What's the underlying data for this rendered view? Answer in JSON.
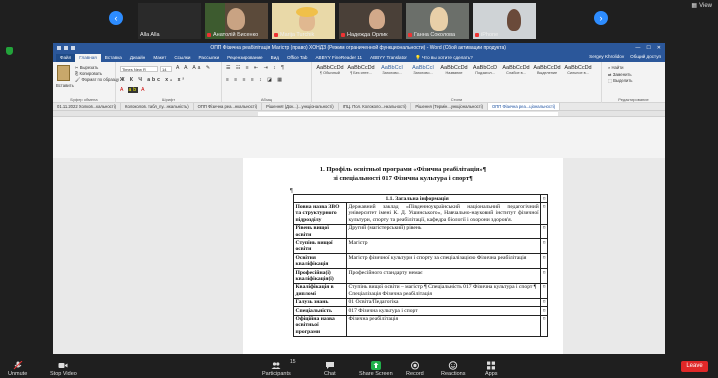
{
  "zoom": {
    "view_label": "View",
    "participants": [
      {
        "name": "Alla Alla",
        "muted": false
      },
      {
        "name": "Анатолій Бисенко",
        "muted": true
      },
      {
        "name": "Marija Turchik",
        "muted": true
      },
      {
        "name": "Надежда Орлик",
        "muted": true
      },
      {
        "name": "Ганна Соколова",
        "muted": true
      },
      {
        "name": "iPhone",
        "muted": true
      }
    ],
    "toolbar": {
      "unmute": "Unmute",
      "stop_video": "Stop Video",
      "participants": "Participants",
      "participants_count": "15",
      "chat": "Chat",
      "share_screen": "Share Screen",
      "record": "Record",
      "reactions": "Reactions",
      "apps": "Apps",
      "leave": "Leave"
    }
  },
  "word": {
    "window_title": "ОПП Фізична реабілітація  Магістр (право) ХОНДЗ (Режим ограниченной функциональности) - Word (Сбой активации продукта)",
    "tabs": [
      "Файл",
      "Главная",
      "Вставка",
      "Дизайн",
      "Макет",
      "Ссылки",
      "Рассылки",
      "Рецензирование",
      "Вид",
      "Office Tab",
      "ABBYY FineReader 11",
      "ABBYY Translator"
    ],
    "active_tab": "Главная",
    "tell_me": "Что вы хотите сделать?",
    "user": "Sergey Khrolidov",
    "share": "Общий доступ",
    "clipboard": {
      "paste": "Вставить",
      "cut": "Вырезать",
      "copy": "Копировать",
      "format_painter": "Формат по образцу",
      "group": "Буфер обмена"
    },
    "font": {
      "name": "Times New R",
      "size": "14",
      "group": "Шрифт"
    },
    "paragraph": {
      "group": "Абзац"
    },
    "styles": {
      "group": "Стили",
      "items": [
        {
          "sample": "AaBbCcDd",
          "name": "¶ Обычный"
        },
        {
          "sample": "AaBbCcDd",
          "name": "¶ Без инте..."
        },
        {
          "sample": "AaBbCcI",
          "name": "Заголово..."
        },
        {
          "sample": "AaBbCcI",
          "name": "Заголово..."
        },
        {
          "sample": "AaBbCcDd",
          "name": "Название"
        },
        {
          "sample": "AaBbCcD",
          "name": "Подзагол..."
        },
        {
          "sample": "AaBbCcDd",
          "name": "Слабое в..."
        },
        {
          "sample": "AaBbCcDd",
          "name": "Выделение"
        },
        {
          "sample": "AaBbCcDd",
          "name": "Сильное в..."
        }
      ]
    },
    "editing": {
      "find": "Найти",
      "replace": "Заменить",
      "select": "Выделить",
      "group": "Редактирование"
    },
    "doc_tabs": [
      {
        "label": "01.11.2022 Холков...кальності)",
        "active": false
      },
      {
        "label": "Колоколов. табл_пу...нкальність)",
        "active": false
      },
      {
        "label": "ОПП Фізична реа...нкальності)",
        "active": false
      },
      {
        "label": "Рішенняї (Док...)...ункціональності)",
        "active": false
      },
      {
        "label": "ІПЦ. Пол. Колоколо...нкальності)",
        "active": false
      },
      {
        "label": "Рішення (Термін...ункціональності)",
        "active": false
      },
      {
        "label": "ОПП Фізична реа...ціональності)",
        "active": true
      }
    ],
    "document": {
      "heading_line1": "1. Профіль освітньої програми «Фізична реабілітація»¶",
      "heading_line2": "зі спеціальності 017 Фізична культура і спорт¶",
      "section_title": "1.1. Загальна інформація",
      "rows": [
        {
          "label": "Повна назва ЗВО та структурного підрозділу",
          "value": "Державний заклад «Південноукраїнський національний педагогічний університет імені К. Д. Ушинського», Навчально-науковий інститут фізичної культури, спорту та реабілітації, кафедра біології і охорони здоров'я."
        },
        {
          "label": "Рівень вищої освіти",
          "value": "Другий (магістерський) рівень"
        },
        {
          "label": "Ступінь вищої освіти",
          "value": "Магістр"
        },
        {
          "label": "Освітня кваліфікація",
          "value": "Магістр фізичної культури і спорту за спеціалізацією Фізична реабілітація"
        },
        {
          "label": "Професійна(і) кваліфікація(ї)",
          "value": "Професійного стандарту немає"
        },
        {
          "label": "Кваліфікація в дипломі",
          "value": "Ступінь вищої освіти – магістр ¶ Спеціальність 017 Фізична культура і спорт ¶ Спеціалізація Фізична реабілітація"
        },
        {
          "label": "Галузь знань",
          "value": "01 Освіта/Педагогіка"
        },
        {
          "label": "Спеціальність",
          "value": "017 Фізична культура і спорт"
        },
        {
          "label": "Офіційна назва освітньої програми",
          "value": "Фізична реабілітація"
        }
      ]
    }
  },
  "colors": {
    "word_blue": "#2b579a",
    "zoom_blue": "#2d8cff",
    "leave_red": "#e02828",
    "share_green": "#21b04b"
  }
}
